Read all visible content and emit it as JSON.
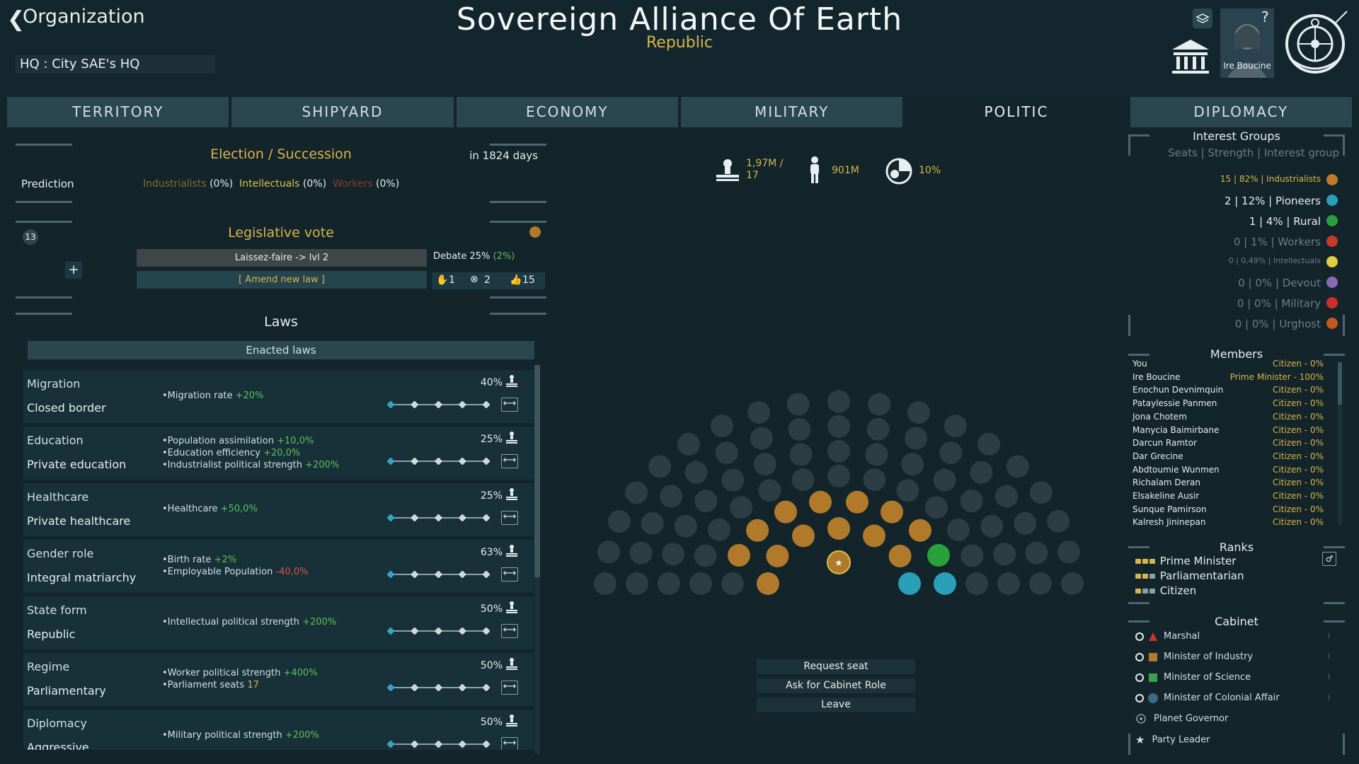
{
  "header": {
    "back_label": "❮",
    "org_label": "Organization",
    "hq_label": "HQ : City SAE's HQ",
    "title": "Sovereign Alliance Of Earth",
    "subtitle": "Republic",
    "leader_name": "Ire Boucine"
  },
  "tabs": [
    "TERRITORY",
    "SHIPYARD",
    "ECONOMY",
    "MILITARY",
    "POLITIC",
    "DIPLOMACY"
  ],
  "election": {
    "title": "Election / Succession",
    "countdown": "in 1824 days",
    "prediction_label": "Prediction",
    "parties": [
      {
        "name": "Industrialists",
        "value": "(0%)",
        "color": "#8a6b2e"
      },
      {
        "name": "Intellectuals",
        "value": "(0%)",
        "color": "#d8c24a"
      },
      {
        "name": "Workers",
        "value": "(0%)",
        "color": "#8c3b2b"
      }
    ]
  },
  "legislative": {
    "title": "Legislative vote",
    "badge": "13",
    "plus": "+",
    "current_law": "Laissez-faire -> lvl 2",
    "amend": "[ Amend new law ]",
    "debate_label": "Debate 25%",
    "debate_extra": "(2%)",
    "votes_against": "1",
    "votes_abstain": "2",
    "votes_for": "15"
  },
  "laws": {
    "title": "Laws",
    "enacted": "Enacted laws",
    "items": [
      {
        "name": "Migration",
        "value": "Closed border",
        "pct": "40%",
        "effects": [
          [
            "Migration rate ",
            "+20%",
            "pos"
          ]
        ]
      },
      {
        "name": "Education",
        "value": "Private education",
        "pct": "25%",
        "effects": [
          [
            "Population assimilation ",
            "+10,0%",
            "pos"
          ],
          [
            "Education efficiency ",
            "+20,0%",
            "pos"
          ],
          [
            "Industrialist political strength ",
            "+200%",
            "pos"
          ]
        ]
      },
      {
        "name": "Healthcare",
        "value": "Private healthcare",
        "pct": "25%",
        "effects": [
          [
            "Healthcare ",
            "+50,0%",
            "pos"
          ]
        ]
      },
      {
        "name": "Gender role",
        "value": "Integral matriarchy",
        "pct": "63%",
        "effects": [
          [
            "Birth rate ",
            "+2%",
            "pos"
          ],
          [
            "Employable Population ",
            "-40,0%",
            "neg"
          ]
        ]
      },
      {
        "name": "State form",
        "value": "Republic",
        "pct": "50%",
        "effects": [
          [
            "Intellectual political strength ",
            "+200%",
            "pos"
          ]
        ]
      },
      {
        "name": "Regime",
        "value": "Parliamentary",
        "pct": "50%",
        "effects": [
          [
            "Worker political strength ",
            "+400%",
            "pos"
          ],
          [
            "Parliament seats ",
            "17",
            "warn"
          ]
        ]
      },
      {
        "name": "Diplomacy",
        "value": "Aggressive",
        "pct": "50%",
        "effects": [
          [
            "Military political strength ",
            "+200%",
            "pos"
          ]
        ]
      }
    ]
  },
  "stats": {
    "seats": "1,97M /",
    "seats2": "17",
    "population": "901M",
    "ratio": "10%"
  },
  "actions": [
    "Request seat",
    "Ask for Cabinet Role",
    "Leave"
  ],
  "interest_groups": {
    "title": "Interest Groups",
    "header": "Seats | Strength | Interest group",
    "rows": [
      {
        "text": "15 | 82% | Industrialists",
        "color": "#c07a2a",
        "text_color": "#d8b64a",
        "size": "12px"
      },
      {
        "text": "2 | 12% | Pioneers",
        "color": "#2a9fb8",
        "text_color": "#e6eef0",
        "size": "15px"
      },
      {
        "text": "1 | 4% | Rural",
        "color": "#2aa03a",
        "text_color": "#e6eef0",
        "size": "15px"
      },
      {
        "text": "0 | 1% | Workers",
        "color": "#c83a2a",
        "text_color": "#6b7f85",
        "size": "15px"
      },
      {
        "text": "0 | 0,49% | Intellectuals",
        "color": "#e0d040",
        "text_color": "#6b7f85",
        "size": "11px"
      },
      {
        "text": "0 | 0% | Devout",
        "color": "#8a6ab8",
        "text_color": "#6b7f85",
        "size": "15px"
      },
      {
        "text": "0 | 0% | Military",
        "color": "#d0302a",
        "text_color": "#6b7f85",
        "size": "15px"
      },
      {
        "text": "0 | 0% | Urghost",
        "color": "#c05a20",
        "text_color": "#6b7f85",
        "size": "15px"
      }
    ]
  },
  "members": {
    "title": "Members",
    "rows": [
      {
        "name": "You",
        "rank": "Citizen - 0%"
      },
      {
        "name": "Ire Boucine",
        "rank": "Prime Minister - 100%"
      },
      {
        "name": "Enochun Devnimquin",
        "rank": "Citizen - 0%"
      },
      {
        "name": "Pataylessie Panmen",
        "rank": "Citizen - 0%"
      },
      {
        "name": "Jona Chotem",
        "rank": "Citizen - 0%"
      },
      {
        "name": "Manycia Baimirbane",
        "rank": "Citizen - 0%"
      },
      {
        "name": "Darcun Ramtor",
        "rank": "Citizen - 0%"
      },
      {
        "name": "Dar Grecine",
        "rank": "Citizen - 0%"
      },
      {
        "name": "Abdtoumie Wunmen",
        "rank": "Citizen - 0%"
      },
      {
        "name": "Richalam Deran",
        "rank": "Citizen - 0%"
      },
      {
        "name": "Elsakeline Ausir",
        "rank": "Citizen - 0%"
      },
      {
        "name": "Sunque Pamirson",
        "rank": "Citizen - 0%"
      },
      {
        "name": "Kalresh Jininepan",
        "rank": "Citizen - 0%"
      }
    ]
  },
  "ranks": {
    "title": "Ranks",
    "items": [
      "Prime Minister",
      "Parliamentarian",
      "Citizen"
    ]
  },
  "cabinet": {
    "title": "Cabinet",
    "items": [
      {
        "label": "Marshal",
        "icon_color": "#d0302a"
      },
      {
        "label": "Minister of Industry",
        "icon_color": "#b07a2a"
      },
      {
        "label": "Minister of Science",
        "icon_color": "#3aa04a"
      },
      {
        "label": "Minister of Colonial Affair",
        "icon_color": "#3a6a8a"
      },
      {
        "label": "Planet Governor",
        "icon_color": "#8aa1a8"
      },
      {
        "label": "Party Leader",
        "icon_color": "#c9d6da"
      }
    ]
  }
}
